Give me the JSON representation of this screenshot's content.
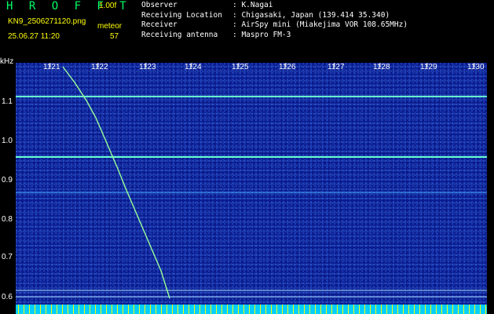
{
  "header": {
    "logo": "H R O F F T",
    "version": "1.00f",
    "filename": "KN9_2506271120.png",
    "mode": "meteor",
    "datetime": "25.06.27 11:20",
    "count": "57"
  },
  "info": [
    {
      "label": "Observer",
      "value": ": K.Nagai"
    },
    {
      "label": "Receiving Location",
      "value": ": Chigasaki, Japan (139.414 35.340)"
    },
    {
      "label": "Receiver",
      "value": ": AirSpy mini (Miakejima VOR 108.65MHz)"
    },
    {
      "label": "Receiving antenna",
      "value": ": Maspro FM-3"
    }
  ],
  "axis": {
    "y_unit": "kHz",
    "x_ticks": [
      "1121",
      "1122",
      "1123",
      "1124",
      "1125",
      "1126",
      "1127",
      "1128",
      "1129",
      "1130"
    ],
    "y_ticks": [
      "1.1",
      "1.0",
      "0.9",
      "0.8",
      "0.7",
      "0.6"
    ]
  },
  "colors": {
    "background": "#0a1a8c",
    "signal": "#66ffcc",
    "trail": "#99ff99"
  }
}
